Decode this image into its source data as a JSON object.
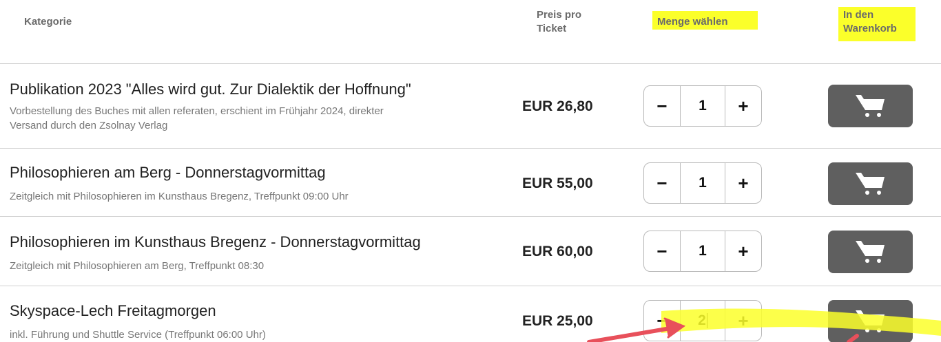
{
  "header": {
    "kategorie": "Kategorie",
    "preis_line1": "Preis pro",
    "preis_line2": "Ticket",
    "menge": "Menge wählen",
    "warenkorb_line1": "In den",
    "warenkorb_line2": "Warenkorb"
  },
  "rows": [
    {
      "title": "Publikation 2023 \"Alles wird gut. Zur Dialektik der Hoffnung\"",
      "desc_line1": "Vorbestellung des Buches mit allen referaten, erschient im Frühjahr 2024, direkter",
      "desc_line2": "Versand durch den Zsolnay Verlag",
      "price": "EUR 26,80",
      "qty": "1"
    },
    {
      "title": "Philosophieren am Berg - Donnerstagvormittag",
      "desc_line1": "Zeitgleich mit Philosophieren im Kunsthaus Bregenz, Treffpunkt 09:00 Uhr",
      "price": "EUR 55,00",
      "qty": "1"
    },
    {
      "title": "Philosophieren im Kunsthaus Bregenz - Donnerstagvormittag",
      "desc_line1": "Zeitgleich mit Philosophieren am Berg, Treffpunkt 08:30",
      "price": "EUR 60,00",
      "qty": "1"
    },
    {
      "title": "Skyspace-Lech Freitagmorgen",
      "desc_line1": "inkl. Führung und Shuttle Service (Treffpunkt 06:00 Uhr)",
      "price": "EUR 25,00",
      "qty": "2"
    }
  ],
  "stepper": {
    "minus": "−",
    "plus": "+"
  },
  "icons": {
    "cart": "shopping-cart-icon"
  },
  "colors": {
    "highlight": "#fbff2a",
    "cart_button": "#5f5f5f",
    "annotation_arrow": "#e8505b"
  }
}
